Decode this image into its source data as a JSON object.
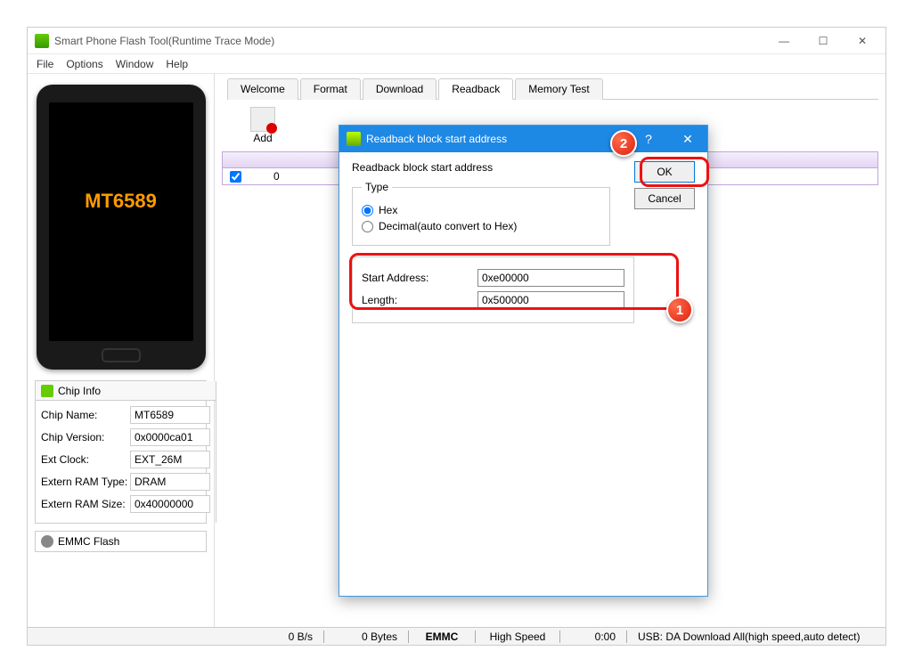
{
  "window": {
    "title": "Smart Phone Flash Tool(Runtime Trace Mode)",
    "min": "—",
    "max": "☐",
    "close": "✕"
  },
  "menu": {
    "file": "File",
    "options": "Options",
    "window": "Window",
    "help": "Help"
  },
  "phone": {
    "brand": "MT6589"
  },
  "chipInfo": {
    "title": "Chip Info",
    "rows": [
      {
        "label": "Chip Name:",
        "value": "MT6589"
      },
      {
        "label": "Chip Version:",
        "value": "0x0000ca01"
      },
      {
        "label": "Ext Clock:",
        "value": "EXT_26M"
      },
      {
        "label": "Extern RAM Type:",
        "value": "DRAM"
      },
      {
        "label": "Extern RAM Size:",
        "value": "0x40000000"
      }
    ]
  },
  "emmc": {
    "title": "EMMC Flash"
  },
  "tabs": {
    "welcome": "Welcome",
    "format": "Format",
    "download": "Download",
    "readback": "Readback",
    "memtest": "Memory Test"
  },
  "toolbar": {
    "add": "Add"
  },
  "grid": {
    "cell0": "0"
  },
  "status": {
    "speed": "0 B/s",
    "bytes": "0 Bytes",
    "storage": "EMMC",
    "mode": "High Speed",
    "time": "0:00",
    "usb": "USB: DA Download All(high speed,auto detect)"
  },
  "dialog": {
    "title": "Readback block start address",
    "help": "?",
    "close": "✕",
    "heading": "Readback block start address",
    "type_legend": "Type",
    "hex": "Hex",
    "dec": "Decimal(auto convert to Hex)",
    "startLabel": "Start Address:",
    "startValue": "0xe00000",
    "lengthLabel": "Length:",
    "lengthValue": "0x500000",
    "ok": "OK",
    "cancel": "Cancel"
  },
  "badges": {
    "one": "1",
    "two": "2"
  }
}
